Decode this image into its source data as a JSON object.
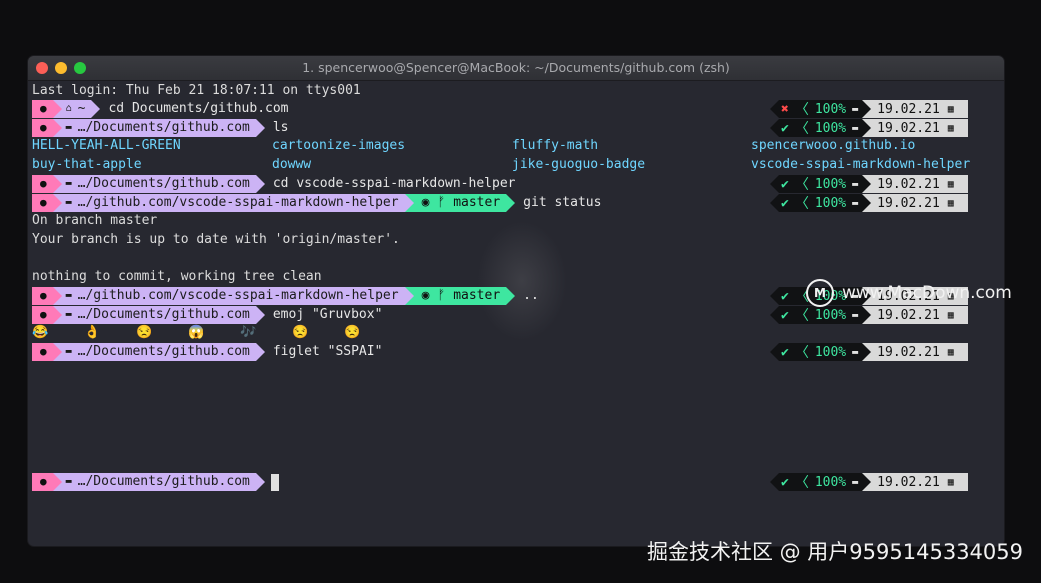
{
  "window": {
    "title": "1. spencerwoo@Spencer@MacBook: ~/Documents/github.com (zsh)"
  },
  "terminal": {
    "last_login": "Last login: Thu Feb 21 18:07:11 on ttys001",
    "icons": {
      "apple": "apple-icon",
      "home": "home-icon",
      "folder": "folder-icon",
      "branch": "git-branch-icon",
      "github": "github-icon",
      "calendar": "calendar-icon"
    },
    "colors": {
      "apple_segment": "#ff7ab8",
      "path_segment": "#ccb3f5",
      "git_segment": "#3ee6a0",
      "status_ok": "#3ee6a0",
      "status_error": "#ff4b4b",
      "date_segment": "#d9d9d9",
      "listing": "#6fd6ff"
    },
    "prompts": [
      {
        "path": "~",
        "command": "cd Documents/github.com"
      },
      {
        "path": "…/Documents/github.com",
        "command": "ls"
      },
      {
        "path": "…/Documents/github.com",
        "command": "cd vscode-sspai-markdown-helper"
      },
      {
        "path": "…/github.com/vscode-sspai-markdown-helper",
        "branch": "master",
        "command": "git status"
      },
      {
        "path": "…/github.com/vscode-sspai-markdown-helper",
        "branch": "master",
        "command": ".."
      },
      {
        "path": "…/Documents/github.com",
        "command": "emoj \"Gruvbox\""
      },
      {
        "path": "…/Documents/github.com",
        "command": "figlet \"SSPAI\""
      },
      {
        "path": "…/Documents/github.com",
        "command": ""
      }
    ],
    "ls_output": [
      [
        "HELL-YEAH-ALL-GREEN",
        "cartoonize-images",
        "fluffy-math",
        "spencerwooo.github.io"
      ],
      [
        "buy-that-apple",
        "dowww",
        "jike-guoguo-badge",
        "vscode-sspai-markdown-helper"
      ]
    ],
    "git_output": [
      "On branch master",
      "Your branch is up to date with 'origin/master'.",
      "",
      "nothing to commit, working tree clean"
    ],
    "emoji_output": "😂 👌 😒 😱 🎶 😒 😒",
    "right_prompts": [
      {
        "status": "✖",
        "percent": "100%",
        "date": "19.02.21"
      },
      {
        "status": "✔",
        "percent": "100%",
        "date": "19.02.21"
      },
      {
        "status": "✔",
        "percent": "100%",
        "date": "19.02.21"
      },
      {
        "status": "✔",
        "percent": "100%",
        "date": "19.02.21"
      },
      {
        "status": "✔",
        "percent": "100%",
        "date": "19.02.21"
      },
      {
        "status": "✔",
        "percent": "100%",
        "date": "19.02.21"
      },
      {
        "status": "✔",
        "percent": "100%",
        "date": "19.02.21"
      },
      {
        "status": "✔",
        "percent": "100%",
        "date": "19.02.21"
      }
    ]
  },
  "watermarks": {
    "macdown_logo": "M",
    "macdown": "www.MacDown.com",
    "juejin": "掘金技术社区 @ 用户9595145334059"
  }
}
